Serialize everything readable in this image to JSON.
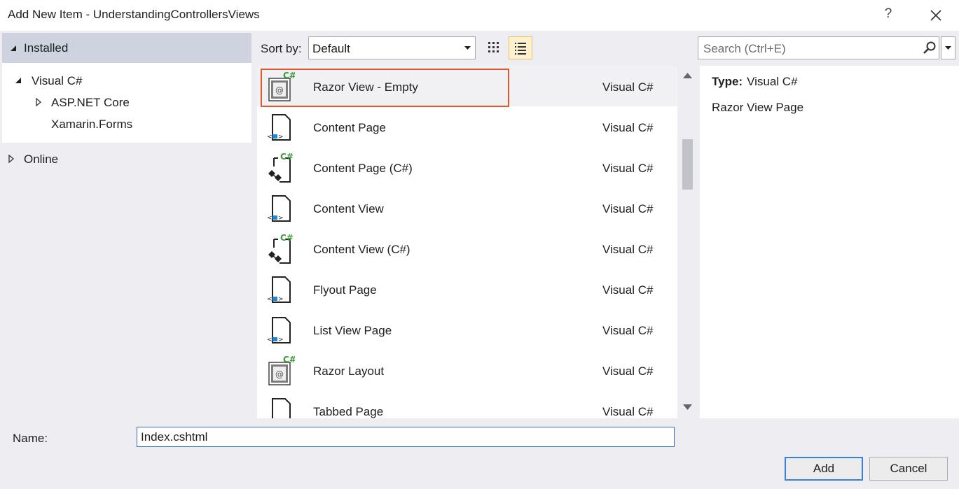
{
  "window": {
    "title": "Add New Item - UnderstandingControllersViews",
    "help_label": "?"
  },
  "sidebar": {
    "installed_label": "Installed",
    "tree": {
      "root_label": "Visual C#",
      "children": [
        "ASP.NET Core",
        "Xamarin.Forms"
      ]
    },
    "online_label": "Online"
  },
  "toolbar": {
    "sort_label": "Sort by:",
    "sort_value": "Default"
  },
  "templates": [
    {
      "name": "Razor View - Empty",
      "lang": "Visual C#",
      "icon": "razor-icon",
      "selected": true
    },
    {
      "name": "Content Page",
      "lang": "Visual C#",
      "icon": "xaml-page-icon"
    },
    {
      "name": "Content Page (C#)",
      "lang": "Visual C#",
      "icon": "csharp-page-icon"
    },
    {
      "name": "Content View",
      "lang": "Visual C#",
      "icon": "xaml-page-icon"
    },
    {
      "name": "Content View (C#)",
      "lang": "Visual C#",
      "icon": "csharp-page-icon"
    },
    {
      "name": "Flyout Page",
      "lang": "Visual C#",
      "icon": "xaml-page-icon"
    },
    {
      "name": "List View Page",
      "lang": "Visual C#",
      "icon": "xaml-page-icon"
    },
    {
      "name": "Razor Layout",
      "lang": "Visual C#",
      "icon": "razor-icon"
    },
    {
      "name": "Tabbed Page",
      "lang": "Visual C#",
      "icon": "xaml-page-icon"
    }
  ],
  "search": {
    "placeholder": "Search (Ctrl+E)"
  },
  "details": {
    "type_label": "Type:",
    "type_value": "Visual C#",
    "description": "Razor View Page"
  },
  "footer": {
    "name_label": "Name:",
    "name_value": "Index.cshtml",
    "add_label": "Add",
    "cancel_label": "Cancel"
  },
  "colors": {
    "highlight_border": "#e0592e",
    "selected_tree_bg": "#cfd3df",
    "csharp_green": "#3a9a3a",
    "xaml_blue": "#1f8ad2"
  }
}
